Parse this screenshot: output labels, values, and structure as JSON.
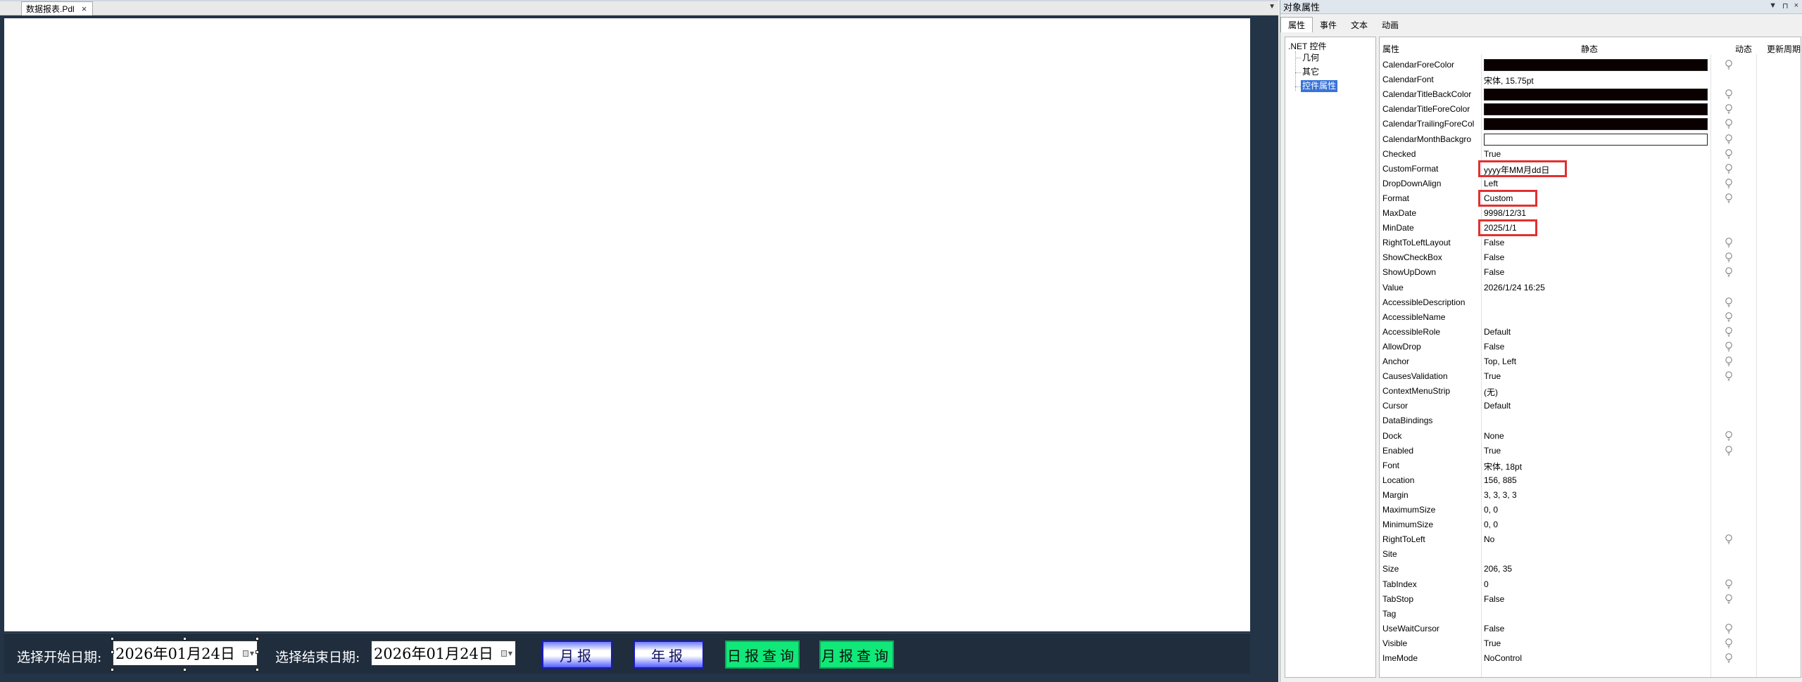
{
  "document_tab": {
    "title": "数据报表.Pdl",
    "close_glyph": "×",
    "dropdown_glyph": "▼"
  },
  "form": {
    "start_label": "选择开始日期:",
    "start_value": "2026年01月24日",
    "end_label": "选择结束日期:",
    "end_value": "2026年01月24日",
    "buttons": [
      {
        "label": "月报",
        "style": "blue"
      },
      {
        "label": "年报",
        "style": "blue"
      },
      {
        "label": "日报查询",
        "style": "green"
      },
      {
        "label": "月报查询",
        "style": "green"
      }
    ]
  },
  "panel": {
    "title": "对象属性",
    "controls": [
      "▼",
      "⊓",
      "×"
    ],
    "tabs": [
      "属性",
      "事件",
      "文本",
      "动画"
    ],
    "active_tab": "属性",
    "tree": {
      "root": ".NET 控件",
      "children": [
        "几何",
        "其它",
        "控件属性"
      ],
      "selected": "控件属性"
    },
    "columns": {
      "name": "属性",
      "static": "静态",
      "dynamic": "动态",
      "period": "更新周期"
    },
    "properties": [
      {
        "name": "CalendarForeColor",
        "swatch": "#0a0000",
        "bulb": true
      },
      {
        "name": "CalendarFont",
        "value": "宋体, 15.75pt",
        "bulb": false
      },
      {
        "name": "CalendarTitleBackColor",
        "swatch": "#0a0000",
        "bulb": true
      },
      {
        "name": "CalendarTitleForeColor",
        "swatch": "#0a0000",
        "bulb": true
      },
      {
        "name": "CalendarTrailingForeCol",
        "swatch": "#0a0000",
        "bulb": true
      },
      {
        "name": "CalendarMonthBackgro",
        "swatch": "#ffffff",
        "bulb": true
      },
      {
        "name": "Checked",
        "value": "True",
        "bulb": true
      },
      {
        "name": "CustomFormat",
        "value": "yyyy年MM月dd日",
        "bulb": true,
        "highlight": true
      },
      {
        "name": "DropDownAlign",
        "value": "Left",
        "bulb": true
      },
      {
        "name": "Format",
        "value": "Custom",
        "bulb": true,
        "highlight": true
      },
      {
        "name": "MaxDate",
        "value": "9998/12/31",
        "bulb": false
      },
      {
        "name": "MinDate",
        "value": "2025/1/1",
        "bulb": false,
        "highlight": true
      },
      {
        "name": "RightToLeftLayout",
        "value": "False",
        "bulb": true
      },
      {
        "name": "ShowCheckBox",
        "value": "False",
        "bulb": true
      },
      {
        "name": "ShowUpDown",
        "value": "False",
        "bulb": true
      },
      {
        "name": "Value",
        "value": "2026/1/24 16:25",
        "bulb": false
      },
      {
        "name": "AccessibleDescription",
        "value": "",
        "bulb": true
      },
      {
        "name": "AccessibleName",
        "value": "",
        "bulb": true
      },
      {
        "name": "AccessibleRole",
        "value": "Default",
        "bulb": true
      },
      {
        "name": "AllowDrop",
        "value": "False",
        "bulb": true
      },
      {
        "name": "Anchor",
        "value": "Top, Left",
        "bulb": true
      },
      {
        "name": "CausesValidation",
        "value": "True",
        "bulb": true
      },
      {
        "name": "ContextMenuStrip",
        "value": "(无)",
        "bulb": false
      },
      {
        "name": "Cursor",
        "value": "Default",
        "bulb": false
      },
      {
        "name": "DataBindings",
        "value": "",
        "bulb": false
      },
      {
        "name": "Dock",
        "value": "None",
        "bulb": true
      },
      {
        "name": "Enabled",
        "value": "True",
        "bulb": true
      },
      {
        "name": "Font",
        "value": "宋体, 18pt",
        "bulb": false
      },
      {
        "name": "Location",
        "value": "156, 885",
        "bulb": false
      },
      {
        "name": "Margin",
        "value": "3, 3, 3, 3",
        "bulb": false
      },
      {
        "name": "MaximumSize",
        "value": "0, 0",
        "bulb": false
      },
      {
        "name": "MinimumSize",
        "value": "0, 0",
        "bulb": false
      },
      {
        "name": "RightToLeft",
        "value": "No",
        "bulb": true
      },
      {
        "name": "Site",
        "value": "",
        "bulb": false
      },
      {
        "name": "Size",
        "value": "206, 35",
        "bulb": false
      },
      {
        "name": "TabIndex",
        "value": "0",
        "bulb": true
      },
      {
        "name": "TabStop",
        "value": "False",
        "bulb": true
      },
      {
        "name": "Tag",
        "value": "",
        "bulb": false
      },
      {
        "name": "UseWaitCursor",
        "value": "False",
        "bulb": true
      },
      {
        "name": "Visible",
        "value": "True",
        "bulb": true
      },
      {
        "name": "ImeMode",
        "value": "NoControl",
        "bulb": true
      }
    ]
  }
}
